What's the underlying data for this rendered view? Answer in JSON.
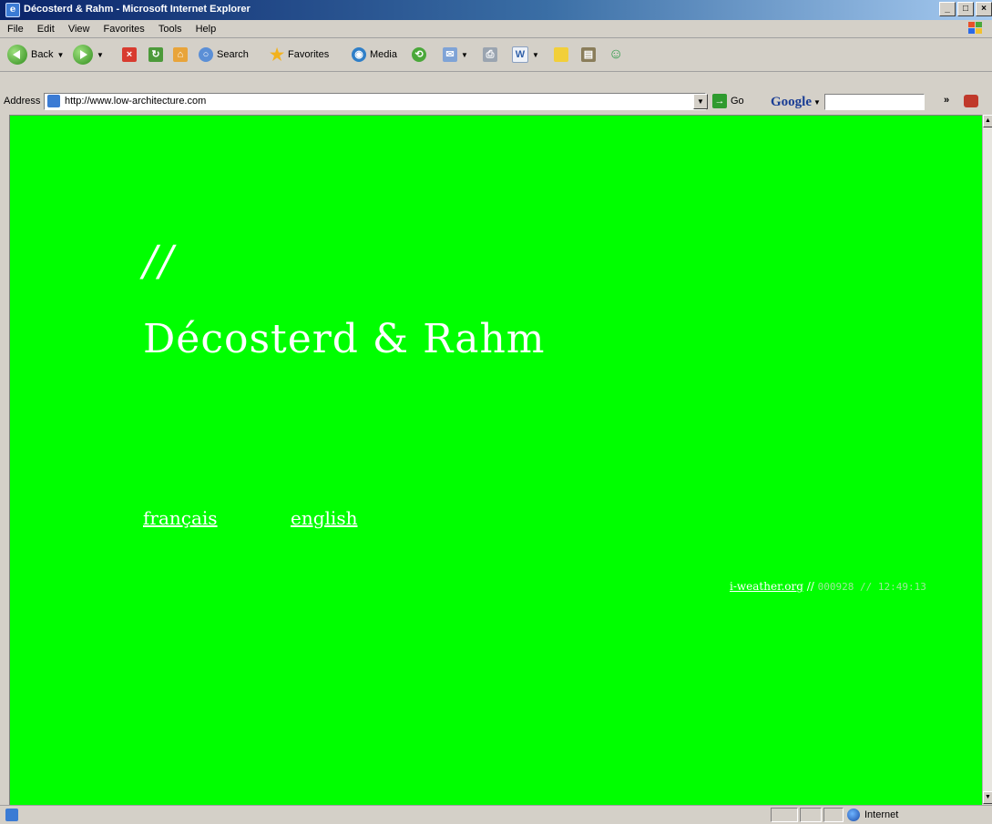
{
  "window": {
    "title": "Décosterd & Rahm - Microsoft Internet Explorer",
    "controls": [
      "_",
      "□",
      "×"
    ]
  },
  "menu": {
    "items": [
      "File",
      "Edit",
      "View",
      "Favorites",
      "Tools",
      "Help"
    ]
  },
  "toolbar": {
    "back_label": "Back",
    "search_label": "Search",
    "favorites_label": "Favorites",
    "media_label": "Media",
    "icons": [
      "back-icon",
      "forward-icon",
      "stop-icon",
      "refresh-icon",
      "home-icon",
      "search-icon",
      "favorites-icon",
      "media-icon",
      "history-icon",
      "mail-icon",
      "print-icon",
      "edit-icon",
      "folder-icon",
      "research-icon",
      "messenger-icon"
    ]
  },
  "address": {
    "label": "Address",
    "url": "http://www.low-architecture.com",
    "go_label": "Go",
    "google_label": "Google",
    "google_value": ""
  },
  "page": {
    "background": "#00ff00",
    "slashes": "//",
    "brand": "Décosterd & Rahm",
    "lang_fr": "français",
    "lang_en": "english",
    "weather_link": "i-weather.org",
    "weather_sep": " // ",
    "weather_code": "000928 // 12:49:13"
  },
  "status": {
    "zone": "Internet"
  }
}
